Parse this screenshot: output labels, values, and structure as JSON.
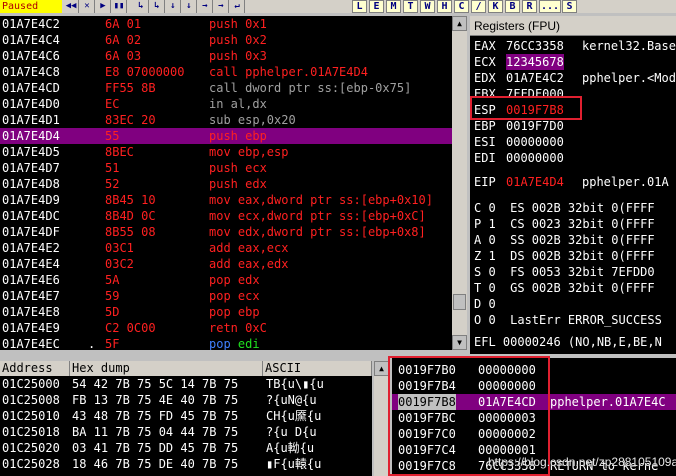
{
  "status": "Paused",
  "toolbar": {
    "buttons": [
      "◀◀",
      "✕",
      "▶",
      "▮▮",
      "↳",
      "↳",
      "↓",
      "↓",
      "→",
      "→",
      "↵"
    ],
    "letters": [
      "L",
      "E",
      "M",
      "T",
      "W",
      "H",
      "C",
      "/",
      "K",
      "B",
      "R",
      "...",
      "S"
    ]
  },
  "colors": {
    "red": "#ff2020",
    "selected": "#800080",
    "highlight_box": "#e02030",
    "gray_text": "#a0a0a0"
  },
  "disasm": [
    {
      "addr": "01A7E4C2",
      "mark": "",
      "hex": "6A 01",
      "instr": "push 0x1"
    },
    {
      "addr": "01A7E4C4",
      "mark": "",
      "hex": "6A 02",
      "instr": "push 0x2"
    },
    {
      "addr": "01A7E4C6",
      "mark": "",
      "hex": "6A 03",
      "instr": "push 0x3"
    },
    {
      "addr": "01A7E4C8",
      "mark": "",
      "hex": "E8 07000000",
      "instr": "call pphelper.01A7E4D4"
    },
    {
      "addr": "01A7E4CD",
      "mark": "",
      "hex": "FF55 8B",
      "instr": "call dword ptr ss:[ebp-0x75]"
    },
    {
      "addr": "01A7E4D0",
      "mark": "",
      "hex": "EC",
      "instr": "in al,dx"
    },
    {
      "addr": "01A7E4D1",
      "mark": "",
      "hex": "83EC 20",
      "instr": "sub esp,0x20"
    },
    {
      "addr": "01A7E4D4",
      "mark": "",
      "hex": "55",
      "instr": "push ebp"
    },
    {
      "addr": "01A7E4D5",
      "mark": "",
      "hex": "8BEC",
      "instr": "mov ebp,esp"
    },
    {
      "addr": "01A7E4D7",
      "mark": "",
      "hex": "51",
      "instr": "push ecx"
    },
    {
      "addr": "01A7E4D8",
      "mark": "",
      "hex": "52",
      "instr": "push edx"
    },
    {
      "addr": "01A7E4D9",
      "mark": "",
      "hex": "8B45 10",
      "instr": "mov eax,dword ptr ss:[ebp+0x10]"
    },
    {
      "addr": "01A7E4DC",
      "mark": "",
      "hex": "8B4D 0C",
      "instr": "mov ecx,dword ptr ss:[ebp+0xC]"
    },
    {
      "addr": "01A7E4DF",
      "mark": "",
      "hex": "8B55 08",
      "instr": "mov edx,dword ptr ss:[ebp+0x8]"
    },
    {
      "addr": "01A7E4E2",
      "mark": "",
      "hex": "03C1",
      "instr": "add eax,ecx"
    },
    {
      "addr": "01A7E4E4",
      "mark": "",
      "hex": "03C2",
      "instr": "add eax,edx"
    },
    {
      "addr": "01A7E4E6",
      "mark": "",
      "hex": "5A",
      "instr": "pop edx"
    },
    {
      "addr": "01A7E4E7",
      "mark": "",
      "hex": "59",
      "instr": "pop ecx"
    },
    {
      "addr": "01A7E4E8",
      "mark": "",
      "hex": "5D",
      "instr": "pop ebp"
    },
    {
      "addr": "01A7E4E9",
      "mark": "",
      "hex": "C2 0C00",
      "instr": "retn 0xC"
    },
    {
      "addr": "01A7E4EC",
      "mark": ".",
      "hex": "5F",
      "instr_op": "pop",
      "instr_arg": "edi"
    }
  ],
  "registers": {
    "title": "Registers (FPU)",
    "rows": [
      {
        "name": "EAX",
        "val": "76CC3358",
        "info": "kernel32.Base"
      },
      {
        "name": "ECX",
        "val": "12345678",
        "info": ""
      },
      {
        "name": "EDX",
        "val": "01A7E4C2",
        "info": "pphelper.<Mod"
      },
      {
        "name": "EBX",
        "val": "7FFDF000",
        "info": ""
      },
      {
        "name": "ESP",
        "val": "0019F7B8",
        "info": ""
      },
      {
        "name": "EBP",
        "val": "0019F7D0",
        "info": ""
      },
      {
        "name": "ESI",
        "val": "00000000",
        "info": ""
      },
      {
        "name": "EDI",
        "val": "00000000",
        "info": ""
      },
      {
        "name": "EIP",
        "val": "01A7E4D4",
        "info": "pphelper.01A"
      }
    ],
    "segments": [
      "C 0  ES 002B 32bit 0(FFFF",
      "P 1  CS 0023 32bit 0(FFFF",
      "A 0  SS 002B 32bit 0(FFFF",
      "Z 1  DS 002B 32bit 0(FFFF",
      "S 0  FS 0053 32bit 7EFDD0",
      "T 0  GS 002B 32bit 0(FFFF",
      "D 0",
      "O 0  LastErr ERROR_SUCCESS"
    ],
    "efl": "EFL 00000246 (NO,NB,E,BE,N"
  },
  "dump": {
    "headers": [
      "Address",
      "Hex dump",
      "ASCII"
    ],
    "rows": [
      {
        "addr": "01C25000",
        "hex": "54 42 7B 75 5C 14 7B 75",
        "ascii": "TB{u\\▮{u"
      },
      {
        "addr": "01C25008",
        "hex": "FB 13 7B 75 4E 40 7B 75",
        "ascii": "?{uN@{u"
      },
      {
        "addr": "01C25010",
        "hex": "43 48 7B 75 FD 45 7B 75",
        "ascii": "CH{u黡{u"
      },
      {
        "addr": "01C25018",
        "hex": "BA 11 7B 75 04 44 7B 75",
        "ascii": "?{u D{u"
      },
      {
        "addr": "01C25020",
        "hex": "03 41 7B 75 DD 45 7B 75",
        "ascii": "A{u軪{u"
      },
      {
        "addr": "01C25028",
        "hex": "18 46 7B 75 DE 40 7B 75",
        "ascii": "▮F{u轅{u"
      }
    ]
  },
  "stack": [
    {
      "addr": "0019F7B0",
      "val": "00000000",
      "comment": ""
    },
    {
      "addr": "0019F7B4",
      "val": "00000000",
      "comment": ""
    },
    {
      "addr": "0019F7B8",
      "val": "01A7E4CD",
      "comment": "pphelper.01A7E4C"
    },
    {
      "addr": "0019F7BC",
      "val": "00000003",
      "comment": ""
    },
    {
      "addr": "0019F7C0",
      "val": "00000002",
      "comment": ""
    },
    {
      "addr": "0019F7C4",
      "val": "00000001",
      "comment": ""
    },
    {
      "addr": "0019F7C8",
      "val": "76CC3358",
      "comment": "RETURN to kerne"
    }
  ],
  "watermark": "https://blog.csdn.net/zp288105109a"
}
